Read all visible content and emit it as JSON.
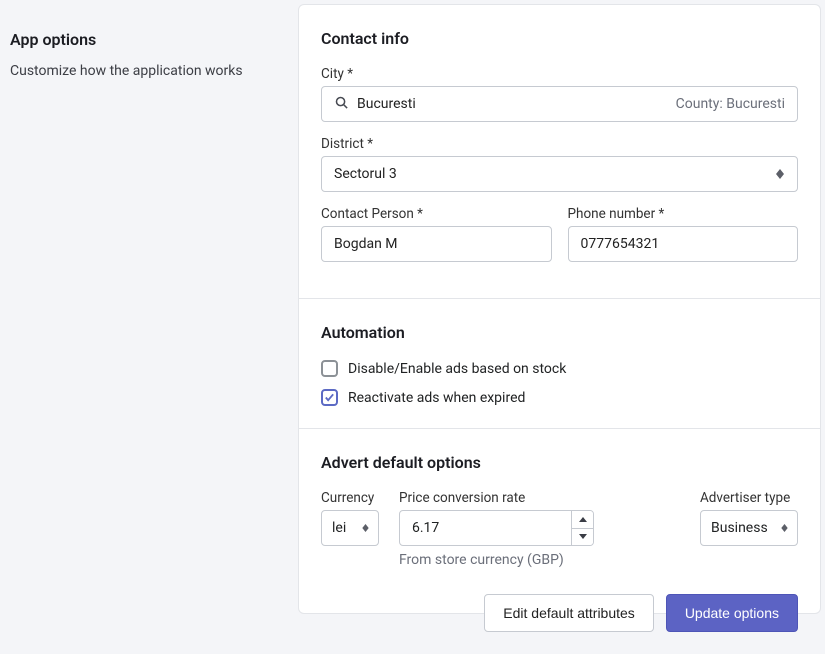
{
  "sidebar": {
    "title": "App options",
    "subtitle": "Customize how the application works"
  },
  "contact": {
    "heading": "Contact info",
    "city_label": "City *",
    "city_value": "Bucuresti",
    "county_label": "County: Bucuresti",
    "district_label": "District *",
    "district_value": "Sectorul 3",
    "person_label": "Contact Person *",
    "person_value": "Bogdan M",
    "phone_label": "Phone number *",
    "phone_value": "0777654321"
  },
  "automation": {
    "heading": "Automation",
    "stock_label": "Disable/Enable ads based on stock",
    "stock_checked": false,
    "reactivate_label": "Reactivate ads when expired",
    "reactivate_checked": true
  },
  "advert": {
    "heading": "Advert default options",
    "currency_label": "Currency",
    "currency_value": "lei",
    "rate_label": "Price conversion rate",
    "rate_value": "6.17",
    "rate_hint": "From store currency (GBP)",
    "advertiser_label": "Advertiser type",
    "advertiser_value": "Business"
  },
  "footer": {
    "edit_label": "Edit default attributes",
    "update_label": "Update options"
  }
}
